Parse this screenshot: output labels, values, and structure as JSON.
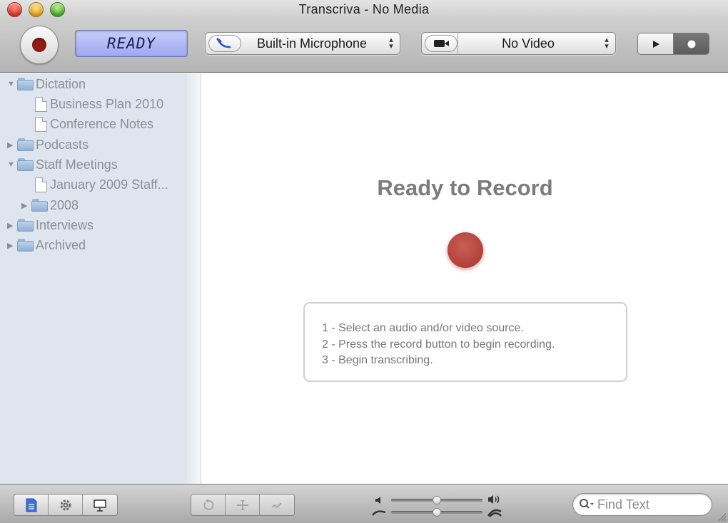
{
  "window": {
    "title": "Transcriva - No Media"
  },
  "toolbar": {
    "status_display": "READY",
    "audio_source": {
      "selected": "Built-in Microphone",
      "icon": "microphone-icon"
    },
    "video_source": {
      "selected": "No Video",
      "icon": "video-camera-icon"
    },
    "mode_segment": {
      "selected": "record"
    }
  },
  "sidebar": {
    "items": [
      {
        "type": "folder",
        "label": "Dictation",
        "expanded": true,
        "level": 0
      },
      {
        "type": "document",
        "label": "Business Plan 2010",
        "level": 1
      },
      {
        "type": "document",
        "label": "Conference Notes",
        "level": 1
      },
      {
        "type": "folder",
        "label": "Podcasts",
        "expanded": false,
        "level": 0
      },
      {
        "type": "folder",
        "label": "Staff Meetings",
        "expanded": true,
        "level": 0
      },
      {
        "type": "document",
        "label": "January 2009 Staff...",
        "level": 1
      },
      {
        "type": "folder",
        "label": "2008",
        "expanded": false,
        "level": 1
      },
      {
        "type": "folder",
        "label": "Interviews",
        "expanded": false,
        "level": 0
      },
      {
        "type": "folder",
        "label": "Archived",
        "expanded": false,
        "level": 0
      }
    ]
  },
  "main": {
    "heading": "Ready to Record",
    "instructions": [
      "1 - Select an audio and/or video source.",
      "2 - Press the record button to begin recording.",
      "3 - Begin transcribing."
    ]
  },
  "bottom": {
    "search": {
      "placeholder": "Find Text"
    },
    "volume_level": 0.5,
    "speed_level": 0.5
  },
  "colors": {
    "record_red": "#b03f38",
    "lcd_blue": "#9ea9f0",
    "sidebar_bg": "#dfe5ee"
  }
}
